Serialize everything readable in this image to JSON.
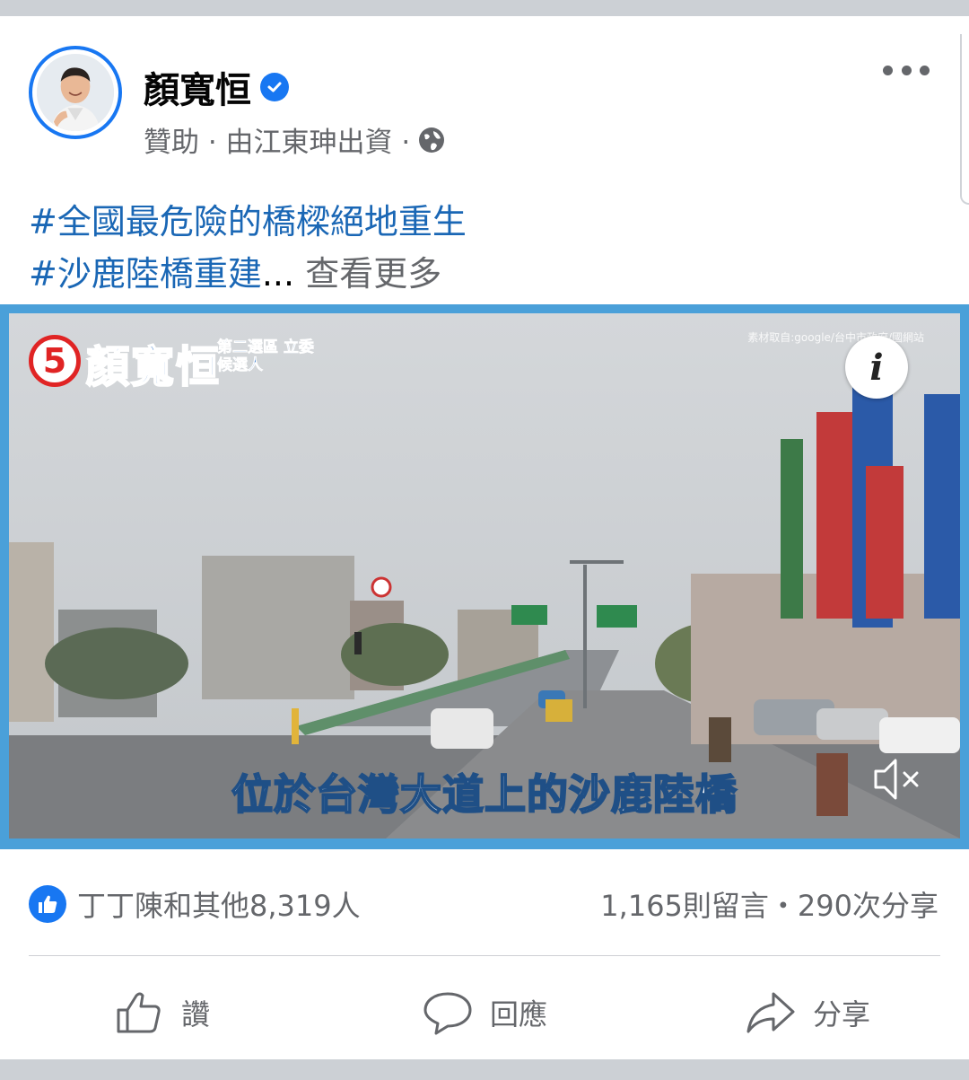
{
  "post": {
    "page_name": "顏寬恒",
    "meta_text": "贊助 · 由江東珅出資 ·",
    "hashtag_line1": "#全國最危險的橋樑絕地重生",
    "hashtag_line2": "#沙鹿陸橋重建",
    "ellipsis": "...",
    "see_more": "查看更多"
  },
  "video": {
    "badge_number": "5",
    "candidate_name": "顏寬恒",
    "candidate_sub": "第二選區 立委候選人",
    "source_text": "素材取自:google/台中市政府/國網站",
    "info_label": "i",
    "subtitle": "位於台灣大道上的沙鹿陸橋"
  },
  "engagement": {
    "reactions_text": "丁丁陳和其他8,319人",
    "comments_shares": "1,165則留言・290次分享"
  },
  "actions": {
    "like_label": "讚",
    "comment_label": "回應",
    "share_label": "分享"
  },
  "colors": {
    "accent": "#1877f2",
    "hashtag": "#1a67b5",
    "secondary_text": "#65676b",
    "video_border": "#4aa0d9"
  },
  "icons": [
    "verified-icon",
    "globe-icon",
    "more-icon",
    "info-icon",
    "mute-icon",
    "like-icon",
    "thumb-up-icon",
    "comment-icon",
    "share-icon"
  ]
}
